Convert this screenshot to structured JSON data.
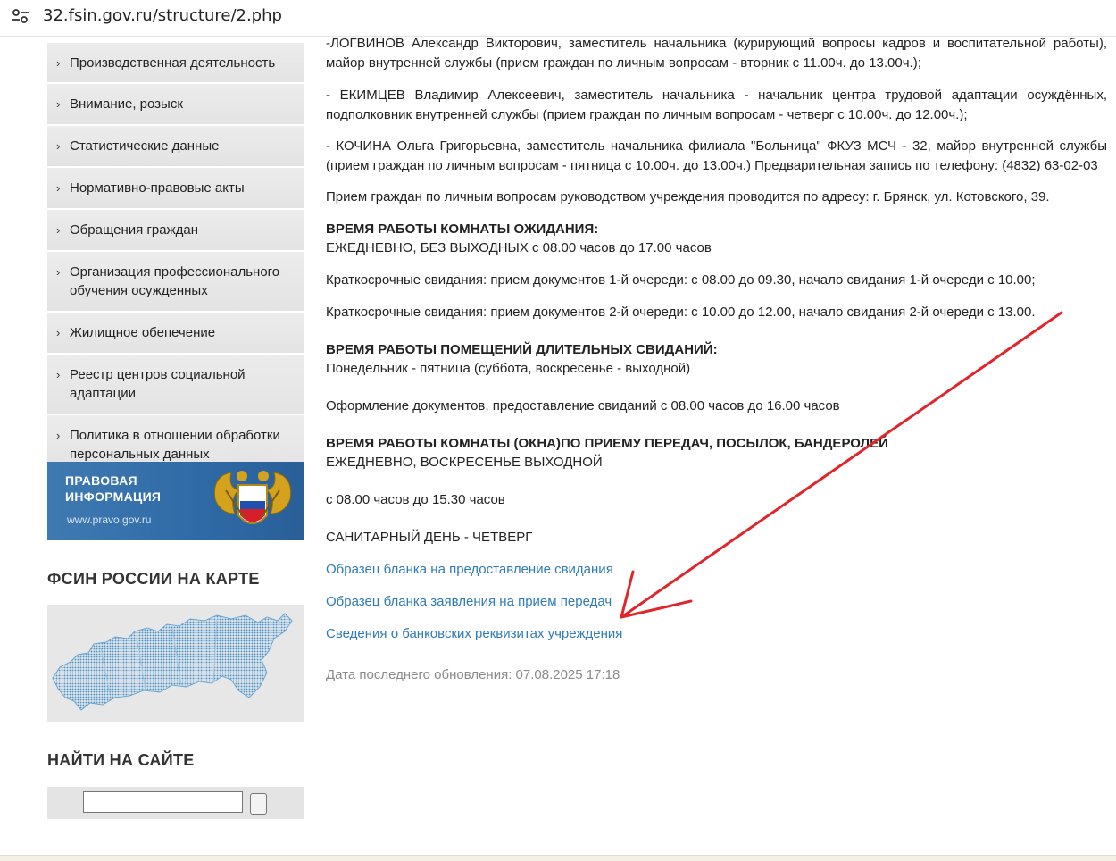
{
  "browser": {
    "url": "32.fsin.gov.ru/structure/2.php"
  },
  "sidebar": {
    "items": [
      {
        "label": "Производственная деятельность"
      },
      {
        "label": "Внимание, розыск"
      },
      {
        "label": "Статистические данные"
      },
      {
        "label": "Нормативно-правовые акты"
      },
      {
        "label": "Обращения граждан"
      },
      {
        "label": "Организация профессионального обучения осужденных"
      },
      {
        "label": "Жилищное обепечение"
      },
      {
        "label": "Реестр центров социальной адаптации"
      },
      {
        "label": "Политика в отношении обработки персональных данных"
      }
    ],
    "chevron": "›",
    "banner": {
      "line1": "ПРАВОВАЯ",
      "line2": "ИНФОРМАЦИЯ",
      "url": "www.pravo.gov.ru"
    },
    "map_heading": "ФСИН РОССИИ НА КАРТЕ",
    "search_heading": "НАЙТИ НА САЙТЕ",
    "search_value": ""
  },
  "main": {
    "p1": "-ЛОГВИНОВ Александр Викторович, заместитель начальника (курирующий вопросы кадров и воспитательной работы), майор внутренней службы   (прием граждан по личным вопросам - вторник  с 11.00ч. до 13.00ч.);",
    "p2": " - ЕКИМЦЕВ Владимир Алексеевич, заместитель начальника - начальник центра трудовой адаптации осуждённых, подполковник внутренней службы  (прием граждан по личным вопросам - четверг  с 10.00ч. до 12.00ч.);",
    "p3": " - КОЧИНА Ольга Григорьевна, заместитель начальника филиала \"Больница\" ФКУЗ МСЧ - 32, майор внутренней службы (прием граждан по личным вопросам - пятница  с 10.00ч. до 13.00ч.) Предварительная запись по телефону: (4832) 63-02-03",
    "p4": "Прием граждан по личным вопросам руководством учреждения проводится по адресу: г. Брянск, ул. Котовского, 39.",
    "h1": "ВРЕМЯ РАБОТЫ КОМНАТЫ ОЖИДАНИЯ:",
    "t1": "ЕЖЕДНЕВНО, БЕЗ ВЫХОДНЫХ с 08.00 часов до 17.00 часов",
    "t2": "Краткосрочные свидания: прием документов 1-й очереди: с 08.00 до 09.30, начало свидания 1-й очереди с 10.00;",
    "t3": "Краткосрочные свидания: прием документов 2-й очереди: с 10.00 до 12.00, начало свидания 2-й очереди с 13.00.",
    "h2": "ВРЕМЯ РАБОТЫ ПОМЕЩЕНИЙ ДЛИТЕЛЬНЫХ СВИДАНИЙ:",
    "t4": "Понедельник - пятница (суббота, воскресенье - выходной)",
    "t5": "Оформление документов, предоставление свиданий с 08.00 часов до 16.00 часов",
    "h3": "ВРЕМЯ РАБОТЫ КОМНАТЫ (ОКНА)ПО ПРИЕМУ ПЕРЕДАЧ, ПОСЫЛОК, БАНДЕРОЛЕЙ",
    "t6": "ЕЖЕДНЕВНО, ВОСКРЕСЕНЬЕ ВЫХОДНОЙ",
    "t7": "с 08.00 часов до 15.30 часов",
    "t8": "САНИТАРНЫЙ ДЕНЬ - ЧЕТВЕРГ",
    "link1": "Образец бланка на предоставление свидания",
    "link2": "Образец бланка заявления на прием передач",
    "link3": "Сведения о банковских реквизитах учреждения",
    "updated": "Дата последнего обновления: 07.08.2025 17:18"
  },
  "colors": {
    "link": "#2e7bb6",
    "annotation_arrow": "#e0262b",
    "banner": "#2f6aa6"
  }
}
